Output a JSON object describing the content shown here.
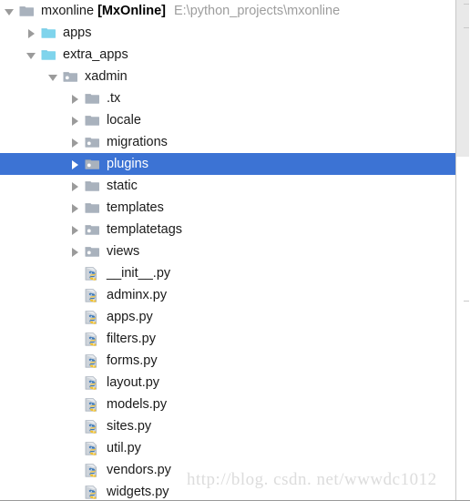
{
  "window": {
    "title": "Project tool window",
    "background": "#ffffff",
    "selection_color": "#3c73d4",
    "source_folder_color": "#7fd4ec",
    "folder_color": "#a9b2bd",
    "path_text_color": "#9d9d9d"
  },
  "watermark": {
    "text": "http://blog. csdn. net/wwwdc1012"
  },
  "scrollbar": {
    "orientation": "vertical",
    "thumb_top": 0,
    "thumb_height": 172
  },
  "tree": {
    "rows": [
      {
        "label": "mxonline",
        "bracket": "[MxOnline]",
        "path": "E:\\python_projects\\mxonline",
        "icon": "folder-icon",
        "twisty": "down",
        "depth": 0,
        "selected": false
      },
      {
        "label": "apps",
        "icon": "source-folder-icon",
        "twisty": "right",
        "depth": 1,
        "selected": false
      },
      {
        "label": "extra_apps",
        "icon": "source-folder-icon",
        "twisty": "down",
        "depth": 1,
        "selected": false
      },
      {
        "label": "xadmin",
        "icon": "package-folder-icon",
        "twisty": "down",
        "depth": 2,
        "selected": false
      },
      {
        "label": ".tx",
        "icon": "folder-icon",
        "twisty": "right",
        "depth": 3,
        "selected": false
      },
      {
        "label": "locale",
        "icon": "folder-icon",
        "twisty": "right",
        "depth": 3,
        "selected": false
      },
      {
        "label": "migrations",
        "icon": "package-folder-icon",
        "twisty": "right",
        "depth": 3,
        "selected": false
      },
      {
        "label": "plugins",
        "icon": "package-folder-icon",
        "twisty": "right",
        "depth": 3,
        "selected": true
      },
      {
        "label": "static",
        "icon": "folder-icon",
        "twisty": "right",
        "depth": 3,
        "selected": false
      },
      {
        "label": "templates",
        "icon": "folder-icon",
        "twisty": "right",
        "depth": 3,
        "selected": false
      },
      {
        "label": "templatetags",
        "icon": "package-folder-icon",
        "twisty": "right",
        "depth": 3,
        "selected": false
      },
      {
        "label": "views",
        "icon": "package-folder-icon",
        "twisty": "right",
        "depth": 3,
        "selected": false
      },
      {
        "label": "__init__.py",
        "icon": "python-file-icon",
        "twisty": "none",
        "depth": 3,
        "selected": false
      },
      {
        "label": "adminx.py",
        "icon": "python-file-icon",
        "twisty": "none",
        "depth": 3,
        "selected": false
      },
      {
        "label": "apps.py",
        "icon": "python-file-icon",
        "twisty": "none",
        "depth": 3,
        "selected": false
      },
      {
        "label": "filters.py",
        "icon": "python-file-icon",
        "twisty": "none",
        "depth": 3,
        "selected": false
      },
      {
        "label": "forms.py",
        "icon": "python-file-icon",
        "twisty": "none",
        "depth": 3,
        "selected": false
      },
      {
        "label": "layout.py",
        "icon": "python-file-icon",
        "twisty": "none",
        "depth": 3,
        "selected": false
      },
      {
        "label": "models.py",
        "icon": "python-file-icon",
        "twisty": "none",
        "depth": 3,
        "selected": false
      },
      {
        "label": "sites.py",
        "icon": "python-file-icon",
        "twisty": "none",
        "depth": 3,
        "selected": false
      },
      {
        "label": "util.py",
        "icon": "python-file-icon",
        "twisty": "none",
        "depth": 3,
        "selected": false
      },
      {
        "label": "vendors.py",
        "icon": "python-file-icon",
        "twisty": "none",
        "depth": 3,
        "selected": false
      },
      {
        "label": "widgets.py",
        "icon": "python-file-icon",
        "twisty": "none",
        "depth": 3,
        "selected": false
      }
    ]
  }
}
